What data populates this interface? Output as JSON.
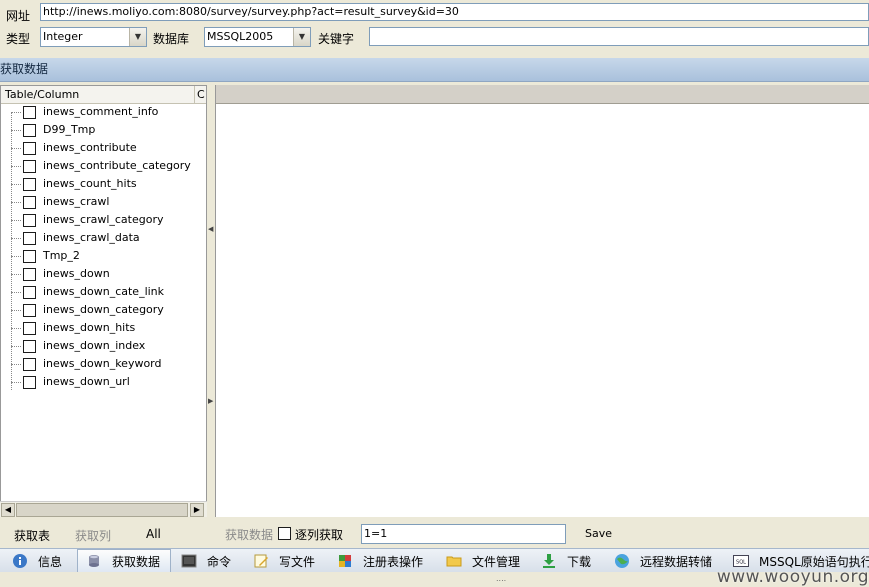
{
  "form": {
    "url_label": "网址",
    "url_value": "http://inews.moliyo.com:8080/survey/survey.php?act=result_survey&id=30",
    "type_label": "类型",
    "type_value": "Integer",
    "db_label": "数据库",
    "db_value": "MSSQL2005",
    "keyword_label": "关键字",
    "keyword_value": ""
  },
  "section_title": "获取数据",
  "tree": {
    "column_header": "Table/Column",
    "column_header2": "C",
    "items": [
      "inews_comment_info",
      "D99_Tmp",
      "inews_contribute",
      "inews_contribute_category",
      "inews_count_hits",
      "inews_crawl",
      "inews_crawl_category",
      "inews_crawl_data",
      "Tmp_2",
      "inews_down",
      "inews_down_cate_link",
      "inews_down_category",
      "inews_down_hits",
      "inews_down_index",
      "inews_down_keyword",
      "inews_down_url"
    ]
  },
  "left_actions": {
    "get_tables": "获取表",
    "get_columns": "获取列",
    "all": "All"
  },
  "right_actions": {
    "get_data": "获取数据",
    "one_by_one": "逐列获取",
    "condition_value": "1=1",
    "save": "Save"
  },
  "tabs": [
    {
      "label": "信息",
      "icon": "info-icon"
    },
    {
      "label": "获取数据",
      "icon": "database-icon"
    },
    {
      "label": "命令",
      "icon": "terminal-icon"
    },
    {
      "label": "写文件",
      "icon": "write-file-icon"
    },
    {
      "label": "注册表操作",
      "icon": "registry-icon"
    },
    {
      "label": "文件管理",
      "icon": "folder-icon"
    },
    {
      "label": "下载",
      "icon": "download-icon"
    },
    {
      "label": "远程数据转储",
      "icon": "globe-icon"
    },
    {
      "label": "MSSQL原始语句执行",
      "icon": "sql-icon"
    }
  ],
  "active_tab": "获取数据",
  "status_dots": "....",
  "watermark": "www.wooyun.org"
}
